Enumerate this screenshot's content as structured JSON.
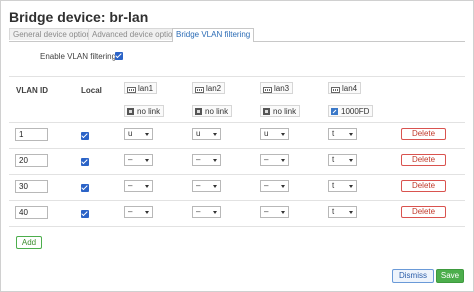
{
  "dialog": {
    "title": "Bridge device: br-lan"
  },
  "tabs": [
    {
      "label": "General device options",
      "active": false
    },
    {
      "label": "Advanced device options",
      "active": false
    },
    {
      "label": "Bridge VLAN filtering",
      "active": true
    }
  ],
  "vlan_filtering": {
    "label": "Enable VLAN filtering",
    "checked": true
  },
  "table": {
    "headers": {
      "vlan_id": "VLAN ID",
      "local": "Local"
    },
    "ports": [
      {
        "name": "lan1",
        "status": "no link",
        "status_icon": "plug-disconnected-icon"
      },
      {
        "name": "lan2",
        "status": "no link",
        "status_icon": "plug-disconnected-icon"
      },
      {
        "name": "lan3",
        "status": "no link",
        "status_icon": "plug-disconnected-icon"
      },
      {
        "name": "lan4",
        "status": "1000FD",
        "status_icon": "plug-connected-icon"
      }
    ],
    "rows": [
      {
        "vlan_id": "1",
        "local": true,
        "ports": [
          "u",
          "u",
          "u",
          "t"
        ]
      },
      {
        "vlan_id": "20",
        "local": true,
        "ports": [
          "–",
          "–",
          "–",
          "t"
        ]
      },
      {
        "vlan_id": "30",
        "local": true,
        "ports": [
          "–",
          "–",
          "–",
          "t"
        ]
      },
      {
        "vlan_id": "40",
        "local": true,
        "ports": [
          "–",
          "–",
          "–",
          "t"
        ]
      }
    ],
    "delete_label": "Delete"
  },
  "actions": {
    "add_label": "Add",
    "dismiss_label": "Dismiss",
    "save_label": "Save"
  },
  "colors": {
    "accent": "#2a6bb5",
    "checkbox": "#2b63c7",
    "delete": "#d9534f",
    "save": "#4cae4c"
  }
}
